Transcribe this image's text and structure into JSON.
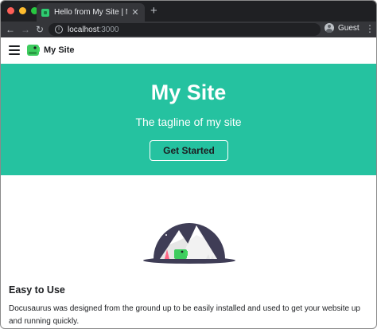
{
  "browser": {
    "tab_title": "Hello from My Site | My Site",
    "tab_close": "✕",
    "new_tab": "+",
    "url_host": "localhost",
    "url_port": ":3000",
    "profile_label": "Guest",
    "colors": {
      "tab_strip": "#1f2023",
      "toolbar": "#35363a",
      "omnibox": "#202124"
    },
    "traffic_lights": [
      "#ff5f57",
      "#febc2e",
      "#28c840"
    ]
  },
  "navbar": {
    "brand": "My Site",
    "icons": [
      "menu-icon",
      "site-logo-icon"
    ]
  },
  "hero": {
    "title": "My Site",
    "tagline": "The tagline of my site",
    "button_label": "Get Started",
    "background": "#25c2a0"
  },
  "feature": {
    "title": "Easy to Use",
    "text": "Docusaurus was designed from the ground up to be easily installed and used to get your website up and running quickly.",
    "illustration": "mountain-dinosaur-illustration"
  }
}
